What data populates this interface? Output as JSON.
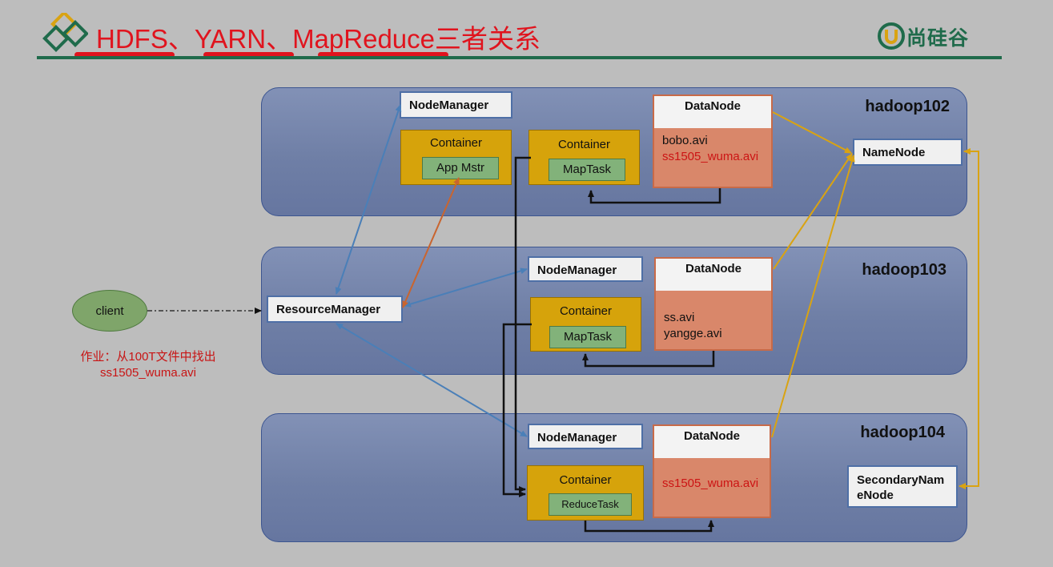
{
  "header": {
    "title": "HDFS、YARN、MapReduce三者关系",
    "logo_text": "尚硅谷"
  },
  "hosts": [
    {
      "label": "hadoop102"
    },
    {
      "label": "hadoop103"
    },
    {
      "label": "hadoop104"
    }
  ],
  "nodemanager": "NodeManager",
  "resourcemanager": "ResourceManager",
  "namenode": "NameNode",
  "secondary_namenode": "SecondaryNameNode",
  "datanode": "DataNode",
  "container": "Container",
  "tasks": {
    "app_master": "App Mstr",
    "map": "MapTask",
    "reduce": "ReduceTask"
  },
  "files": {
    "hadoop102": [
      "bobo.avi",
      "ss1505_wuma.avi"
    ],
    "hadoop103": [
      "ss.avi",
      "yangge.avi"
    ],
    "hadoop104": [
      "ss1505_wuma.avi"
    ]
  },
  "client": "client",
  "job_note": {
    "line1": "作业：从100T文件中找出",
    "line2": "ss1505_wuma.avi"
  },
  "colors": {
    "title_red": "#e0141e",
    "rule_green": "#1f6b4b",
    "blue_arrow": "#4a7fb8",
    "gold_arrow": "#d9a312",
    "orange_arrow": "#c9652f"
  }
}
